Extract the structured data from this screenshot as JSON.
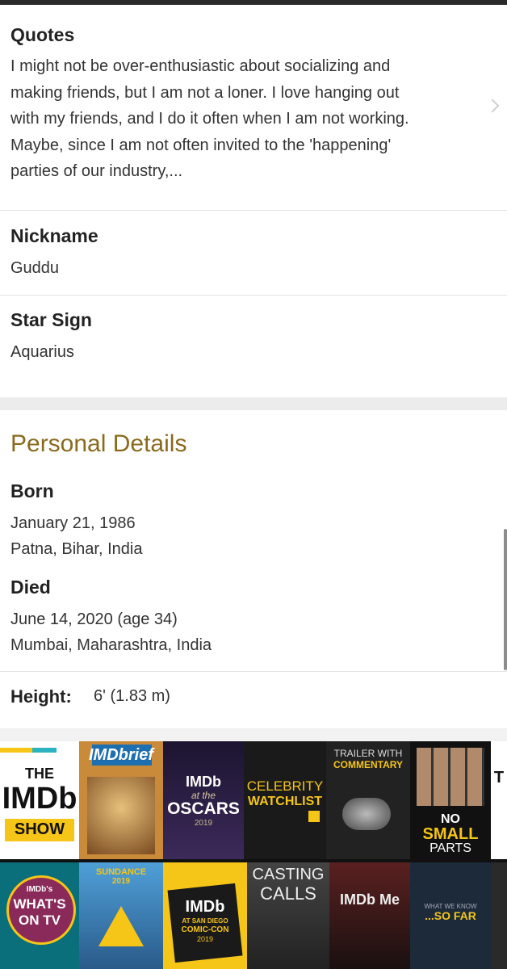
{
  "quotes": {
    "heading": "Quotes",
    "lines": [
      "I might not be over-enthusiastic about socializing and",
      "making friends, but I am not a loner. I love hanging out",
      "with my friends, and I do it often when I am not working.",
      "Maybe, since I am not often invited to the 'happening'",
      "parties of our industry,..."
    ]
  },
  "nickname": {
    "heading": "Nickname",
    "value": "Guddu"
  },
  "star_sign": {
    "heading": "Star Sign",
    "value": "Aquarius"
  },
  "personal_details": {
    "title": "Personal Details",
    "born": {
      "heading": "Born",
      "date": "January 21, 1986",
      "place": "Patna, Bihar, India"
    },
    "died": {
      "heading": "Died",
      "date": "June 14, 2020 (age 34)",
      "place": "Mumbai, Maharashtra, India"
    },
    "height": {
      "label": "Height:",
      "value": "6' (1.83 m)"
    }
  },
  "video_tiles": {
    "imdb_show": [
      "THE",
      "IMDb",
      "SHOW"
    ],
    "imdbrief": "IMDbrief",
    "oscars": [
      "IMDb",
      "at the",
      "OSCARS",
      "2019"
    ],
    "celebrity_watchlist": [
      "CELEBRITY",
      "WATCHLIST"
    ],
    "trailer_commentary": [
      "TRAILER WITH",
      "COMMENTARY"
    ],
    "no_small_parts": [
      "NO",
      "SMALL",
      "PARTS"
    ],
    "edge_top": "T",
    "whats_on_tv": [
      "IMDb's",
      "WHAT'S",
      "ON TV"
    ],
    "sundance": [
      "SUNDANCE",
      "2019"
    ],
    "comic_con": [
      "IMDb",
      "AT SAN DIEGO",
      "COMIC-CON",
      "2019"
    ],
    "casting_calls": [
      "CASTING",
      "CALLS"
    ],
    "imdb_me": "IMDb Me",
    "so_far": [
      "WHAT WE KNOW",
      "...SO FAR"
    ]
  },
  "colors": {
    "accent": "#8a6a1d",
    "imdb_yellow": "#f5c518"
  }
}
